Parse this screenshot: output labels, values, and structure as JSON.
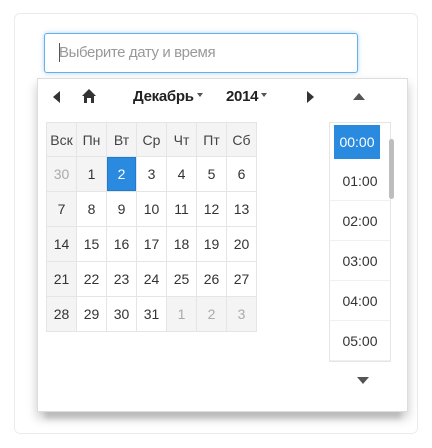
{
  "input": {
    "placeholder": "Выберите дату и время"
  },
  "picker": {
    "month": "Декабрь",
    "year": "2014",
    "weekdays": [
      "Вск",
      "Пн",
      "Вт",
      "Ср",
      "Чт",
      "Пт",
      "Сб"
    ],
    "weeks": [
      [
        "30",
        "1",
        "2",
        "3",
        "4",
        "5",
        "6"
      ],
      [
        "7",
        "8",
        "9",
        "10",
        "11",
        "12",
        "13"
      ],
      [
        "14",
        "15",
        "16",
        "17",
        "18",
        "19",
        "20"
      ],
      [
        "21",
        "22",
        "23",
        "24",
        "25",
        "26",
        "27"
      ],
      [
        "28",
        "29",
        "30",
        "31",
        "1",
        "2",
        "3"
      ]
    ],
    "other_month_cells": [
      [
        0,
        0
      ],
      [
        4,
        4
      ],
      [
        4,
        5
      ],
      [
        4,
        6
      ]
    ],
    "today_cell": [
      0,
      1
    ],
    "selected_cell": [
      0,
      2
    ],
    "times": [
      "00:00",
      "01:00",
      "02:00",
      "03:00",
      "04:00",
      "05:00"
    ],
    "selected_time_index": 0,
    "colors": {
      "accent": "#2a8ae0",
      "focus_border": "#66afe9"
    }
  }
}
